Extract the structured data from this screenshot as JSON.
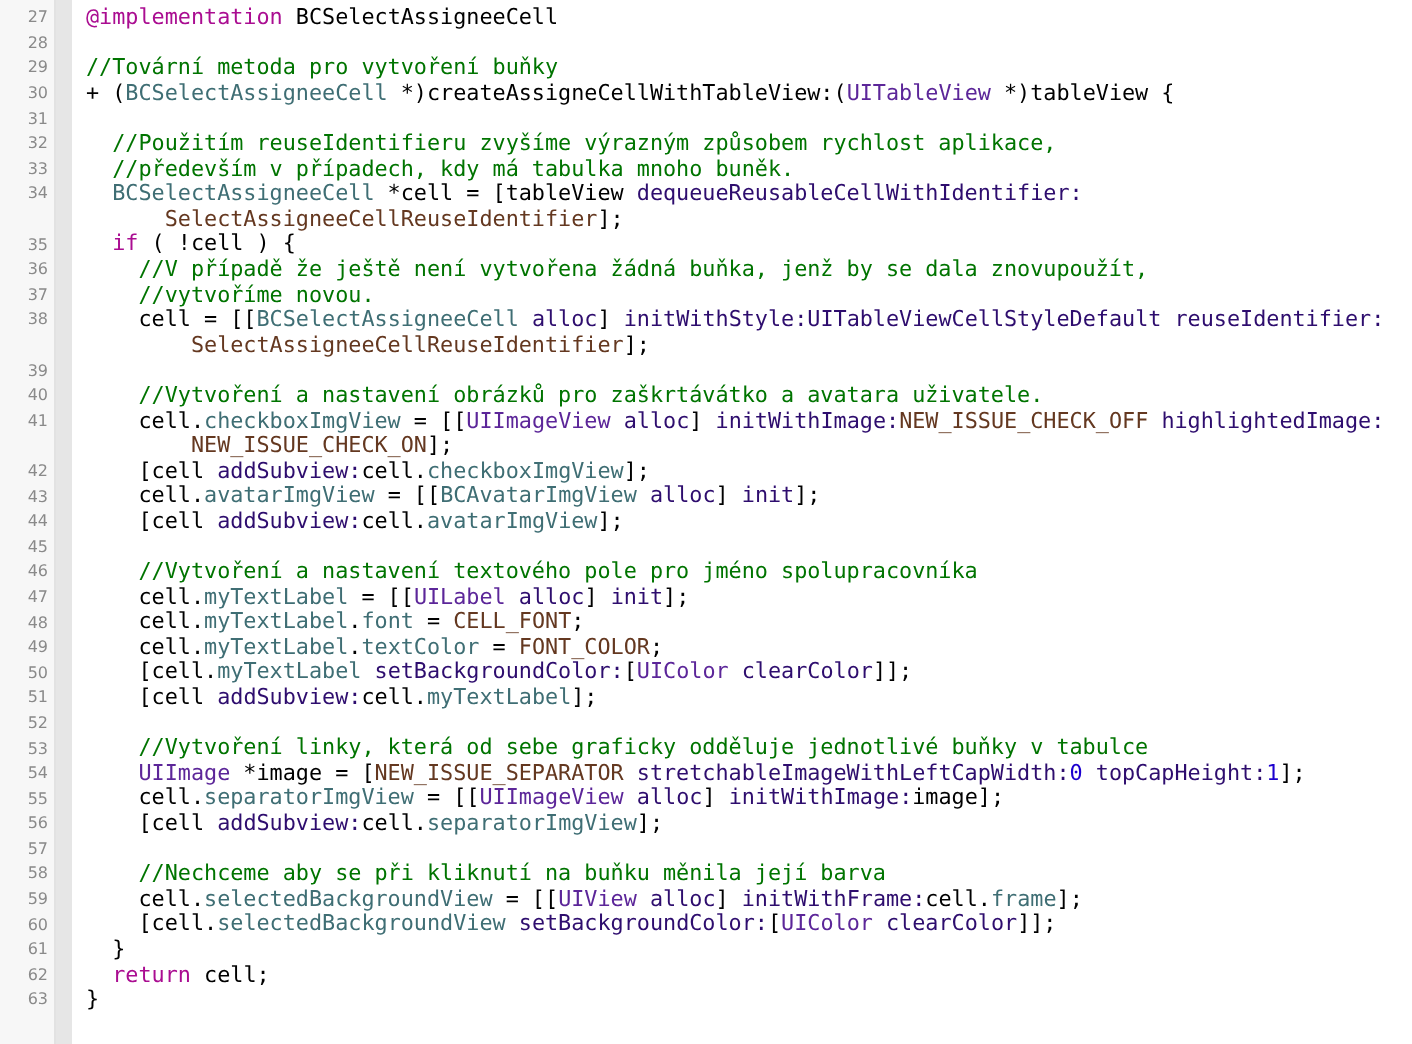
{
  "editor": {
    "lines": [
      {
        "number": "27",
        "tokens": [
          {
            "kind": "keyword",
            "text": "@implementation"
          },
          {
            "kind": "plain",
            "text": " BCSelectAssigneeCell"
          }
        ]
      },
      {
        "number": "28"
      },
      {
        "number": "29",
        "tokens": [
          {
            "kind": "comment",
            "text": "//Tovární metoda pro vytvoření buňky"
          }
        ]
      },
      {
        "number": "30",
        "tokens": [
          {
            "kind": "plain",
            "text": "+ ("
          },
          {
            "kind": "class",
            "text": "BCSelectAssigneeCell"
          },
          {
            "kind": "plain",
            "text": " *)createAssigneCellWithTableView:("
          },
          {
            "kind": "sysclass",
            "text": "UITableView"
          },
          {
            "kind": "plain",
            "text": " *)tableView {"
          }
        ]
      },
      {
        "number": "31"
      },
      {
        "number": "32",
        "tokens": [
          {
            "kind": "comment",
            "text": "  //Použitím reuseIdentifieru zvyšíme výrazným způsobem rychlost aplikace,"
          }
        ]
      },
      {
        "number": "33",
        "tokens": [
          {
            "kind": "comment",
            "text": "  //především v případech, kdy má tabulka mnoho buněk."
          }
        ]
      },
      {
        "number": "34",
        "tokens": [
          {
            "kind": "class",
            "text": "  BCSelectAssigneeCell"
          },
          {
            "kind": "plain",
            "text": " *cell = [tableView "
          },
          {
            "kind": "method",
            "text": "dequeueReusableCellWithIdentifier:"
          }
        ],
        "continuation": [
          {
            "kind": "macro",
            "text": "      SelectAssigneeCellReuseIdentifier"
          },
          {
            "kind": "plain",
            "text": "];"
          }
        ]
      },
      {
        "number": "35",
        "tokens": [
          {
            "kind": "keyword",
            "text": "  if"
          },
          {
            "kind": "plain",
            "text": " ( !cell ) {"
          }
        ]
      },
      {
        "number": "36",
        "tokens": [
          {
            "kind": "comment",
            "text": "    //V případě že ještě není vytvořena žádná buňka, jenž by se dala znovupoužít,"
          }
        ]
      },
      {
        "number": "37",
        "tokens": [
          {
            "kind": "comment",
            "text": "    //vytvoříme novou."
          }
        ]
      },
      {
        "number": "38",
        "tokens": [
          {
            "kind": "plain",
            "text": "    cell = [["
          },
          {
            "kind": "class",
            "text": "BCSelectAssigneeCell"
          },
          {
            "kind": "method",
            "text": " alloc"
          },
          {
            "kind": "plain",
            "text": "] "
          },
          {
            "kind": "method",
            "text": "initWithStyle:UITableViewCellStyleDefault reuseIdentifier:"
          }
        ],
        "continuation": [
          {
            "kind": "macro",
            "text": "        SelectAssigneeCellReuseIdentifier"
          },
          {
            "kind": "plain",
            "text": "];"
          }
        ]
      },
      {
        "number": "39"
      },
      {
        "number": "40",
        "tokens": [
          {
            "kind": "comment",
            "text": "    //Vytvoření a nastavení obrázků pro zaškrtávátko a avatara uživatele."
          }
        ]
      },
      {
        "number": "41",
        "tokens": [
          {
            "kind": "plain",
            "text": "    cell."
          },
          {
            "kind": "property",
            "text": "checkboxImgView"
          },
          {
            "kind": "plain",
            "text": " = [["
          },
          {
            "kind": "sysclass",
            "text": "UIImageView"
          },
          {
            "kind": "method",
            "text": " alloc"
          },
          {
            "kind": "plain",
            "text": "] "
          },
          {
            "kind": "method",
            "text": "initWithImage:"
          },
          {
            "kind": "macro",
            "text": "NEW_ISSUE_CHECK_OFF"
          },
          {
            "kind": "method",
            "text": " highlightedImage:"
          }
        ],
        "continuation": [
          {
            "kind": "macro",
            "text": "        NEW_ISSUE_CHECK_ON"
          },
          {
            "kind": "plain",
            "text": "];"
          }
        ]
      },
      {
        "number": "42",
        "tokens": [
          {
            "kind": "plain",
            "text": "    [cell "
          },
          {
            "kind": "method",
            "text": "addSubview:"
          },
          {
            "kind": "plain",
            "text": "cell."
          },
          {
            "kind": "property",
            "text": "checkboxImgView"
          },
          {
            "kind": "plain",
            "text": "];"
          }
        ]
      },
      {
        "number": "43",
        "tokens": [
          {
            "kind": "plain",
            "text": "    cell."
          },
          {
            "kind": "property",
            "text": "avatarImgView"
          },
          {
            "kind": "plain",
            "text": " = [["
          },
          {
            "kind": "class",
            "text": "BCAvatarImgView"
          },
          {
            "kind": "method",
            "text": " alloc"
          },
          {
            "kind": "plain",
            "text": "] "
          },
          {
            "kind": "method",
            "text": "init"
          },
          {
            "kind": "plain",
            "text": "];"
          }
        ]
      },
      {
        "number": "44",
        "tokens": [
          {
            "kind": "plain",
            "text": "    [cell "
          },
          {
            "kind": "method",
            "text": "addSubview:"
          },
          {
            "kind": "plain",
            "text": "cell."
          },
          {
            "kind": "property",
            "text": "avatarImgView"
          },
          {
            "kind": "plain",
            "text": "];"
          }
        ]
      },
      {
        "number": "45"
      },
      {
        "number": "46",
        "tokens": [
          {
            "kind": "comment",
            "text": "    //Vytvoření a nastavení textového pole pro jméno spolupracovníka"
          }
        ]
      },
      {
        "number": "47",
        "tokens": [
          {
            "kind": "plain",
            "text": "    cell."
          },
          {
            "kind": "property",
            "text": "myTextLabel"
          },
          {
            "kind": "plain",
            "text": " = [["
          },
          {
            "kind": "sysclass",
            "text": "UILabel"
          },
          {
            "kind": "method",
            "text": " alloc"
          },
          {
            "kind": "plain",
            "text": "] "
          },
          {
            "kind": "method",
            "text": "init"
          },
          {
            "kind": "plain",
            "text": "];"
          }
        ]
      },
      {
        "number": "48",
        "tokens": [
          {
            "kind": "plain",
            "text": "    cell."
          },
          {
            "kind": "property",
            "text": "myTextLabel"
          },
          {
            "kind": "plain",
            "text": "."
          },
          {
            "kind": "property",
            "text": "font"
          },
          {
            "kind": "plain",
            "text": " = "
          },
          {
            "kind": "macro",
            "text": "CELL_FONT"
          },
          {
            "kind": "plain",
            "text": ";"
          }
        ]
      },
      {
        "number": "49",
        "tokens": [
          {
            "kind": "plain",
            "text": "    cell."
          },
          {
            "kind": "property",
            "text": "myTextLabel"
          },
          {
            "kind": "plain",
            "text": "."
          },
          {
            "kind": "property",
            "text": "textColor"
          },
          {
            "kind": "plain",
            "text": " = "
          },
          {
            "kind": "macro",
            "text": "FONT_COLOR"
          },
          {
            "kind": "plain",
            "text": ";"
          }
        ]
      },
      {
        "number": "50",
        "tokens": [
          {
            "kind": "plain",
            "text": "    [cell."
          },
          {
            "kind": "property",
            "text": "myTextLabel"
          },
          {
            "kind": "method",
            "text": " setBackgroundColor:"
          },
          {
            "kind": "plain",
            "text": "["
          },
          {
            "kind": "sysclass",
            "text": "UIColor"
          },
          {
            "kind": "method",
            "text": " clearColor"
          },
          {
            "kind": "plain",
            "text": "]];"
          }
        ]
      },
      {
        "number": "51",
        "tokens": [
          {
            "kind": "plain",
            "text": "    [cell "
          },
          {
            "kind": "method",
            "text": "addSubview:"
          },
          {
            "kind": "plain",
            "text": "cell."
          },
          {
            "kind": "property",
            "text": "myTextLabel"
          },
          {
            "kind": "plain",
            "text": "];"
          }
        ]
      },
      {
        "number": "52"
      },
      {
        "number": "53",
        "tokens": [
          {
            "kind": "comment",
            "text": "    //Vytvoření linky, která od sebe graficky odděluje jednotlivé buňky v tabulce"
          }
        ]
      },
      {
        "number": "54",
        "tokens": [
          {
            "kind": "sysclass",
            "text": "    UIImage"
          },
          {
            "kind": "plain",
            "text": " *image = ["
          },
          {
            "kind": "macro",
            "text": "NEW_ISSUE_SEPARATOR"
          },
          {
            "kind": "method",
            "text": " stretchableImageWithLeftCapWidth:"
          },
          {
            "kind": "number",
            "text": "0"
          },
          {
            "kind": "method",
            "text": " topCapHeight:"
          },
          {
            "kind": "number",
            "text": "1"
          },
          {
            "kind": "plain",
            "text": "];"
          }
        ]
      },
      {
        "number": "55",
        "tokens": [
          {
            "kind": "plain",
            "text": "    cell."
          },
          {
            "kind": "property",
            "text": "separatorImgView"
          },
          {
            "kind": "plain",
            "text": " = [["
          },
          {
            "kind": "sysclass",
            "text": "UIImageView"
          },
          {
            "kind": "method",
            "text": " alloc"
          },
          {
            "kind": "plain",
            "text": "] "
          },
          {
            "kind": "method",
            "text": "initWithImage:"
          },
          {
            "kind": "plain",
            "text": "image];"
          }
        ]
      },
      {
        "number": "56",
        "tokens": [
          {
            "kind": "plain",
            "text": "    [cell "
          },
          {
            "kind": "method",
            "text": "addSubview:"
          },
          {
            "kind": "plain",
            "text": "cell."
          },
          {
            "kind": "property",
            "text": "separatorImgView"
          },
          {
            "kind": "plain",
            "text": "];"
          }
        ]
      },
      {
        "number": "57"
      },
      {
        "number": "58",
        "tokens": [
          {
            "kind": "comment",
            "text": "    //Nechceme aby se při kliknutí na buňku měnila její barva"
          }
        ]
      },
      {
        "number": "59",
        "tokens": [
          {
            "kind": "plain",
            "text": "    cell."
          },
          {
            "kind": "property",
            "text": "selectedBackgroundView"
          },
          {
            "kind": "plain",
            "text": " = [["
          },
          {
            "kind": "sysclass",
            "text": "UIView"
          },
          {
            "kind": "method",
            "text": " alloc"
          },
          {
            "kind": "plain",
            "text": "] "
          },
          {
            "kind": "method",
            "text": "initWithFrame:"
          },
          {
            "kind": "plain",
            "text": "cell."
          },
          {
            "kind": "property",
            "text": "frame"
          },
          {
            "kind": "plain",
            "text": "];"
          }
        ]
      },
      {
        "number": "60",
        "tokens": [
          {
            "kind": "plain",
            "text": "    [cell."
          },
          {
            "kind": "property",
            "text": "selectedBackgroundView"
          },
          {
            "kind": "method",
            "text": " setBackgroundColor:"
          },
          {
            "kind": "plain",
            "text": "["
          },
          {
            "kind": "sysclass",
            "text": "UIColor"
          },
          {
            "kind": "method",
            "text": " clearColor"
          },
          {
            "kind": "plain",
            "text": "]];"
          }
        ]
      },
      {
        "number": "61",
        "tokens": [
          {
            "kind": "plain",
            "text": "  }"
          }
        ]
      },
      {
        "number": "62",
        "tokens": [
          {
            "kind": "keyword",
            "text": "  return"
          },
          {
            "kind": "plain",
            "text": " cell;"
          }
        ]
      },
      {
        "number": "63",
        "tokens": [
          {
            "kind": "plain",
            "text": "}"
          }
        ]
      }
    ]
  }
}
